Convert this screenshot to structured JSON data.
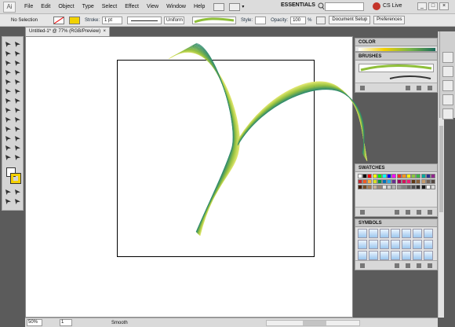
{
  "app": {
    "logo": "Ai",
    "menus": [
      "File",
      "Edit",
      "Object",
      "Type",
      "Select",
      "Effect",
      "View",
      "Window",
      "Help"
    ],
    "workspace": "ESSENTIALS",
    "cs_live": "CS Live",
    "window_buttons": [
      "_",
      "□",
      "×"
    ]
  },
  "control_bar": {
    "selection": "No Selection",
    "stroke_label": "Stroke:",
    "stroke_weight": "1 pt",
    "stroke_profile": "Uniform",
    "style_label": "Style:",
    "opacity_label": "Opacity:",
    "opacity_value": "100",
    "opacity_unit": "%",
    "document_setup": "Document Setup",
    "preferences": "Preferences"
  },
  "document": {
    "tab_title": "Untitled-1* @ 77% (RGB/Preview)",
    "close_glyph": "×",
    "colors": {
      "artwork_light": "#e4e870",
      "artwork_mid": "#98c240",
      "artwork_dark": "#2e8a6e"
    }
  },
  "status_bar": {
    "zoom": "50%",
    "page": "1",
    "status": "Smooth"
  },
  "panels": {
    "color": {
      "title": "COLOR"
    },
    "brushes": {
      "title": "BRUSHES"
    },
    "swatches": {
      "title": "SWATCHES",
      "colors": [
        "#ffffff",
        "#000000",
        "#ff0000",
        "#ffff00",
        "#00ff00",
        "#00ffff",
        "#0000ff",
        "#ff00ff",
        "#ee3224",
        "#f7931e",
        "#fff200",
        "#8cc63f",
        "#39b54a",
        "#00a99d",
        "#2e3192",
        "#92278f",
        "#c1272d",
        "#f15a24",
        "#fbb03b",
        "#d9e021",
        "#009245",
        "#0071bc",
        "#29abe2",
        "#662d91",
        "#9e005d",
        "#d4145a",
        "#ed1e79",
        "#603813",
        "#8c6239",
        "#c69c6d",
        "#736357",
        "#534741",
        "#42210b",
        "#754c24",
        "#a67c52",
        "#c7b299",
        "#998675",
        "#e6e6e6",
        "#cccccc",
        "#b3b3b3",
        "#999999",
        "#808080",
        "#666666",
        "#4d4d4d",
        "#333333",
        "#1a1a1a",
        "#f2f2f2",
        "#d9d9d9"
      ]
    },
    "symbols": {
      "title": "SYMBOLS"
    }
  }
}
